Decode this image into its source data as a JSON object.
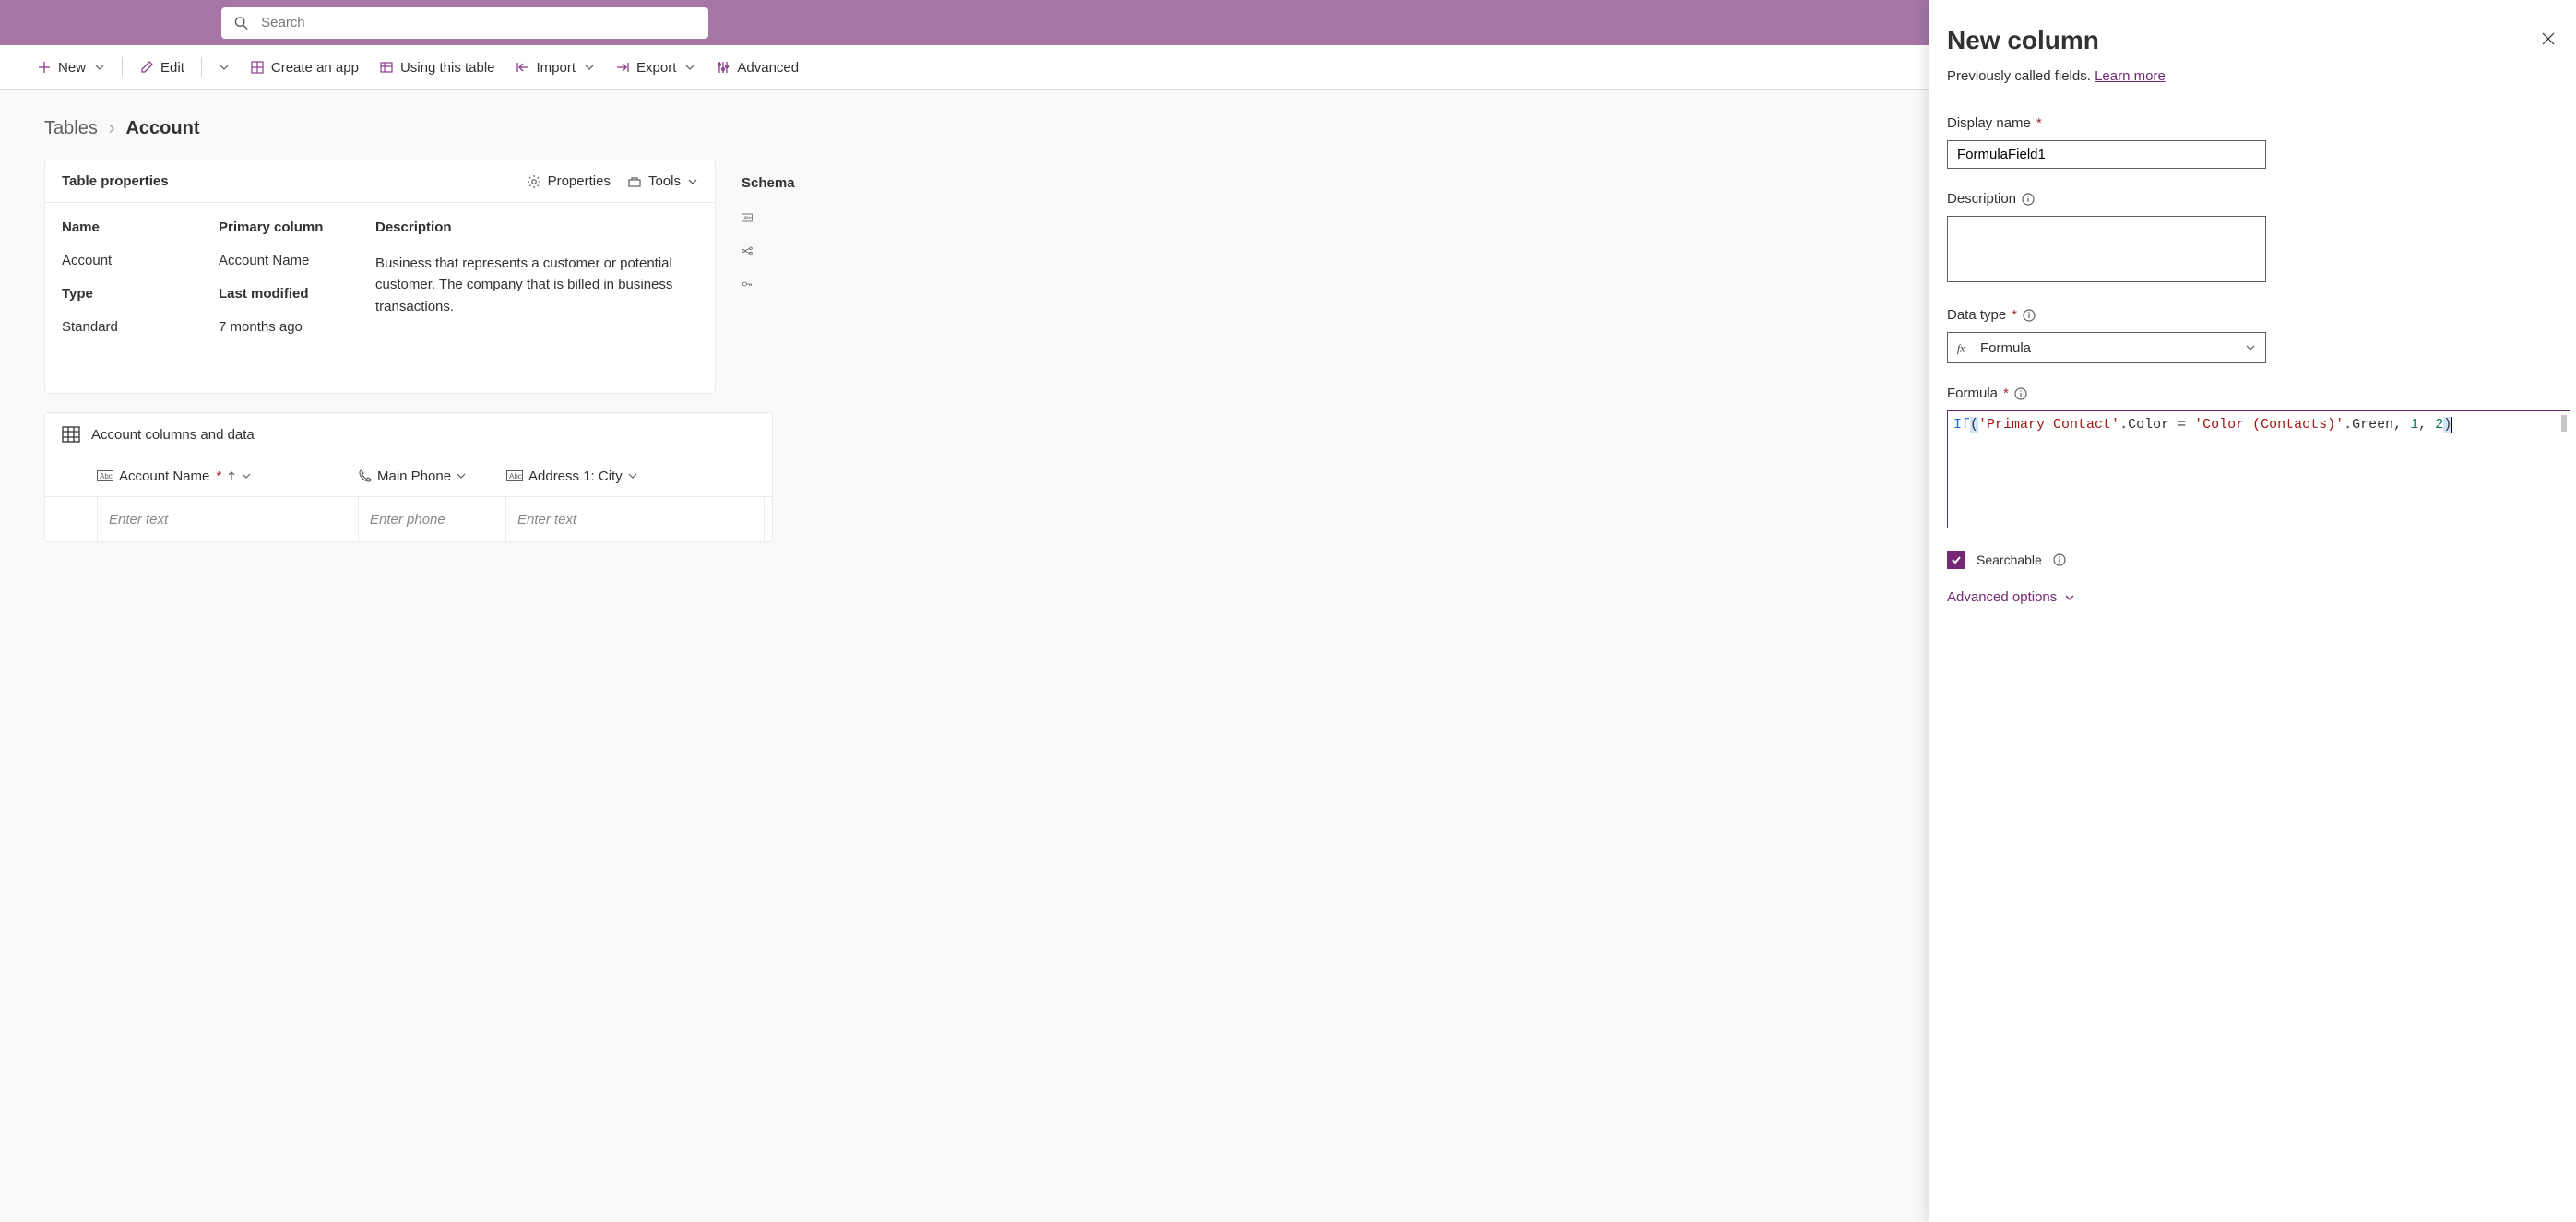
{
  "search": {
    "placeholder": "Search"
  },
  "cmdbar": {
    "new_": "New",
    "edit": "Edit",
    "create": "Create an app",
    "using": "Using this table",
    "import": "Import",
    "export": "Export",
    "adv": "Advanced"
  },
  "breadcrumb": {
    "root": "Tables",
    "leaf": "Account"
  },
  "propsCard": {
    "title": "Table properties",
    "propsBtn": "Properties",
    "toolsBtn": "Tools",
    "name_l": "Name",
    "name_v": "Account",
    "pcol_l": "Primary column",
    "pcol_v": "Account Name",
    "type_l": "Type",
    "type_v": "Standard",
    "lm_l": "Last modified",
    "lm_v": "7 months ago",
    "desc_l": "Description",
    "desc_v": "Business that represents a customer or potential customer. The company that is billed in business transactions."
  },
  "schemaCard": {
    "title": "Schema"
  },
  "dataCard": {
    "title": "Account columns and data",
    "col1": "Account Name",
    "col2": "Main Phone",
    "col3": "Address 1: City",
    "p1": "Enter text",
    "p2": "Enter phone",
    "p3": "Enter text"
  },
  "panel": {
    "heading": "New column",
    "subtext": "Previously called fields. ",
    "learnMore": "Learn more",
    "displayName_l": "Display name",
    "displayName_v": "FormulaField1",
    "description_l": "Description",
    "dataType_l": "Data type",
    "dataType_v": "Formula",
    "formula_l": "Formula",
    "formula": {
      "kw": "If",
      "str1": "'Primary Contact'",
      "prop1": ".Color",
      "eq": " = ",
      "str2": "'Color (Contacts)'",
      "prop2": ".Green",
      "n1": "1",
      "n2": "2"
    },
    "searchable_l": "Searchable",
    "advanced_l": "Advanced options"
  }
}
